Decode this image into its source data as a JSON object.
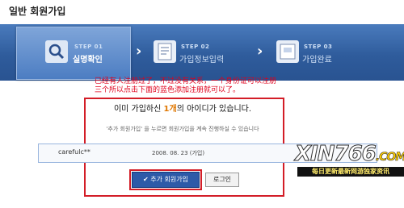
{
  "page": {
    "title": "일반 회원가입"
  },
  "steps": [
    {
      "num": "STEP 01",
      "label": "실명확인",
      "active": true
    },
    {
      "num": "STEP 02",
      "label": "가입정보입력",
      "active": false
    },
    {
      "num": "STEP 03",
      "label": "가입완료",
      "active": false
    }
  ],
  "annotation": {
    "line1": "已经有人注册过了，不过没有关系，一个身份证可以注册",
    "line2": "三个所以点击下面的蓝色添加注册就可以了。"
  },
  "message": {
    "prefix": "이미 가입하신 ",
    "count": "1개",
    "suffix": "의 아이디가 있습니다.",
    "sub": "'추가 회원가입' 을 누르면 회원가입을 계속 진행하실 수 있습니다"
  },
  "account": {
    "id": "carefulc**",
    "date": "2008. 08. 23 (가입)"
  },
  "buttons": {
    "add_member": "추가 회원가입",
    "login": "로그인"
  },
  "watermark": {
    "site": "XIN766",
    "tld": ".COM",
    "slogan": "每日更新最新网游独家资讯"
  },
  "colors": {
    "accent_red": "#d31d27",
    "bar_blue": "#2f5c9c",
    "highlight": "#e07700",
    "button_blue": "#2d5aa8"
  }
}
